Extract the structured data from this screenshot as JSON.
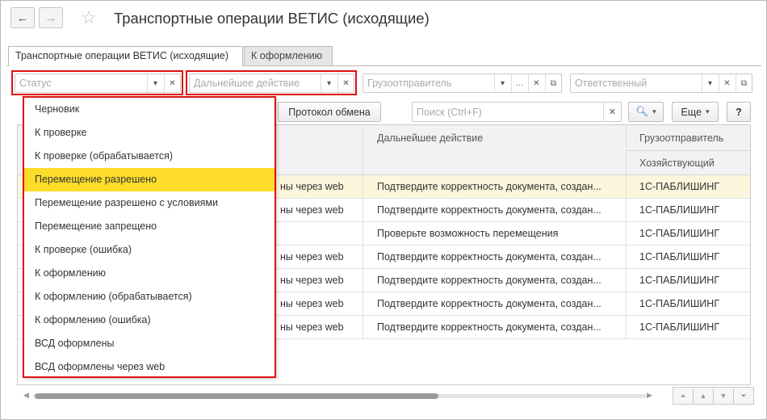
{
  "window": {
    "title": "Транспортные операции ВЕТИС (исходящие)",
    "nav": {
      "back_icon": "←",
      "forward_icon": "→"
    }
  },
  "tabs": [
    {
      "label": "Транспортные операции ВЕТИС (исходящие)"
    },
    {
      "label": "К оформлению"
    }
  ],
  "filters": {
    "status": {
      "placeholder": "Статус"
    },
    "next_action": {
      "placeholder": "Дальнейшее действие"
    },
    "shipper": {
      "placeholder": "Грузоотправитель"
    },
    "responsible": {
      "placeholder": "Ответственный"
    }
  },
  "toolbar": {
    "exchange_protocol": "Протокол обмена",
    "search_placeholder": "Поиск (Ctrl+F)",
    "more": "Еще",
    "help": "?"
  },
  "table": {
    "columns": {
      "next_action": "Дальнейшее действие",
      "shipper": "Грузоотправитель",
      "shipper_sub": "Хозяйствующий"
    },
    "rows": [
      {
        "status_tail": "ны через web",
        "action": "Подтвердите корректность документа, создан...",
        "shipper": "1С-ПАБЛИШИНГ"
      },
      {
        "status_tail": "ны через web",
        "action": "Подтвердите корректность документа, создан...",
        "shipper": "1С-ПАБЛИШИНГ"
      },
      {
        "status_tail": "",
        "action": "Проверьте возможность перемещения",
        "shipper": "1С-ПАБЛИШИНГ"
      },
      {
        "status_tail": "ны через web",
        "action": "Подтвердите корректность документа, создан...",
        "shipper": "1С-ПАБЛИШИНГ"
      },
      {
        "status_tail": "ны через web",
        "action": "Подтвердите корректность документа, создан...",
        "shipper": "1С-ПАБЛИШИНГ"
      },
      {
        "status_tail": "ны через web",
        "action": "Подтвердите корректность документа, создан...",
        "shipper": "1С-ПАБЛИШИНГ"
      },
      {
        "status_tail": "ны через web",
        "action": "Подтвердите корректность документа, создан...",
        "shipper": "1С-ПАБЛИШИНГ"
      }
    ]
  },
  "status_dropdown": {
    "items": [
      "Черновик",
      "К проверке",
      "К проверке (обрабатывается)",
      "Перемещение разрешено",
      "Перемещение разрешено с условиями",
      "Перемещение запрещено",
      "К проверке (ошибка)",
      "К оформлению",
      "К оформлению (обрабатывается)",
      "К оформлению (ошибка)",
      "ВСД оформлены",
      "ВСД оформлены через web"
    ],
    "selected_index": 3
  },
  "colors": {
    "highlight_row": "#fbf6dc",
    "selected_item": "#fddc2a",
    "annotation_red": "#dd1111"
  }
}
